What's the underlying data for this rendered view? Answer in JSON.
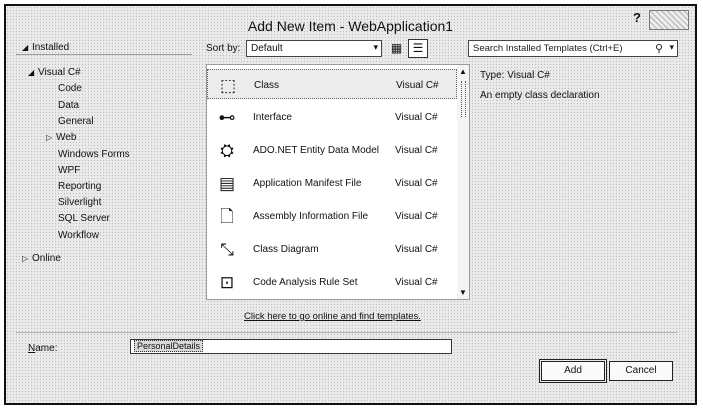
{
  "window": {
    "title": "Add New Item - WebApplication1",
    "help_label": "?"
  },
  "tree": {
    "installed_label": "Installed",
    "root": "Visual C#",
    "children": [
      "Code",
      "Data",
      "General",
      "Web",
      "Windows Forms",
      "WPF",
      "Reporting",
      "Silverlight",
      "SQL Server",
      "Workflow"
    ],
    "online_label": "Online"
  },
  "toolbar": {
    "sortby_label": "Sort by:",
    "sortby_value": "Default",
    "search_placeholder": "Search Installed Templates (Ctrl+E)"
  },
  "templates": [
    {
      "name": "Class",
      "lang": "Visual C#",
      "icon": "class-icon",
      "glyph": "⬚"
    },
    {
      "name": "Interface",
      "lang": "Visual C#",
      "icon": "interface-icon",
      "glyph": "⊷"
    },
    {
      "name": "ADO.NET Entity Data Model",
      "lang": "Visual C#",
      "icon": "entity-model-icon",
      "glyph": "⛭"
    },
    {
      "name": "Application Manifest File",
      "lang": "Visual C#",
      "icon": "manifest-file-icon",
      "glyph": "▤"
    },
    {
      "name": "Assembly Information File",
      "lang": "Visual C#",
      "icon": "assembly-info-icon",
      "glyph": "🗋"
    },
    {
      "name": "Class Diagram",
      "lang": "Visual C#",
      "icon": "class-diagram-icon",
      "glyph": "⤡"
    },
    {
      "name": "Code Analysis Rule Set",
      "lang": "Visual C#",
      "icon": "rule-set-icon",
      "glyph": "⊡"
    }
  ],
  "online_link": "Click here to go online and find templates.",
  "details": {
    "type_label": "Type:",
    "type_value": "Visual C#",
    "description": "An empty class declaration"
  },
  "bottom": {
    "name_label": "Name:",
    "name_value": "PersonalDetails",
    "add_label": "Add",
    "cancel_label": "Cancel"
  }
}
